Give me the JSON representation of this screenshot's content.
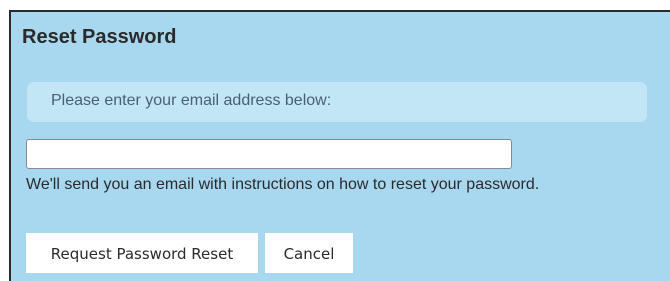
{
  "dialog": {
    "title": "Reset Password",
    "instruction": "Please enter your email address below:",
    "email": {
      "value": "",
      "placeholder": ""
    },
    "help_text": "We'll send you an email with instructions on how to reset your password.",
    "buttons": {
      "request_reset_label": "Request Password Reset",
      "cancel_label": "Cancel"
    }
  },
  "colors": {
    "panel_background": "#a8d8f0",
    "instruction_background": "#c2e6f6",
    "button_background": "#ffffff",
    "border": "#2b2b2b"
  }
}
